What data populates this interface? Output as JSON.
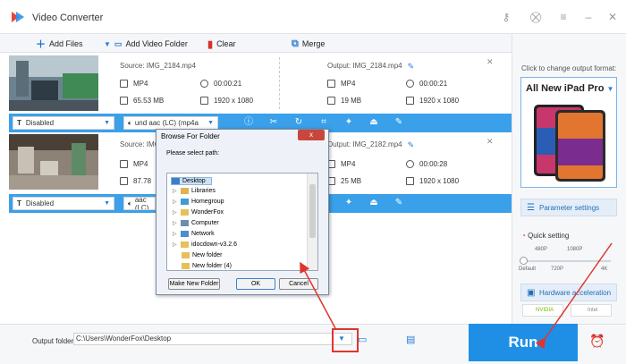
{
  "app": {
    "title": "Video Converter"
  },
  "toolbar": {
    "add_files": "Add Files",
    "add_video_folder": "Add Video Folder",
    "clear": "Clear",
    "merge": "Merge"
  },
  "files": [
    {
      "source": "Source: IMG_2184.mp4",
      "src_format": "MP4",
      "src_duration": "00:00:21",
      "src_size": "65.53 MB",
      "src_resolution": "1920 x 1080",
      "output": "Output: IMG_2184.mp4",
      "out_format": "MP4",
      "out_duration": "00:00:21",
      "out_size": "19 MB",
      "out_resolution": "1920 x 1080",
      "subtitle": "Disabled",
      "audio": "und aac (LC) (mp4a"
    },
    {
      "source": "Source: IMG_2182.mp4",
      "src_format": "MP4",
      "src_duration": "",
      "src_size": "87.78",
      "src_resolution": "",
      "output": "Output: IMG_2182.mp4",
      "out_format": "MP4",
      "out_duration": "00:00:28",
      "out_size": "25 MB",
      "out_resolution": "1920 x 1080",
      "subtitle": "Disabled",
      "audio": "und aac (LC) (mp4a"
    }
  ],
  "dialog": {
    "title": "Browse For Folder",
    "close": "x",
    "prompt": "Please select path:",
    "tree": [
      "Desktop",
      "Libraries",
      "Homegroup",
      "WonderFox",
      "Computer",
      "Network",
      "idocdown-v3.2.6",
      "New folder",
      "New folder (4)"
    ],
    "make_new_folder": "Make New Folder",
    "ok": "OK",
    "cancel": "Cancel"
  },
  "right_panel": {
    "hint": "Click to change output format:",
    "format": "All New iPad Pro",
    "param_settings": "Parameter settings",
    "quick_setting": "Quick setting",
    "q_top": [
      "480P",
      "1080P"
    ],
    "q_bottom": [
      "Default",
      "720P",
      "4K"
    ],
    "hw_accel": "Hardware acceleration",
    "nvidia": "NVIDIA",
    "intel": "Intel"
  },
  "bottom": {
    "output_folder_label": "Output folder:",
    "output_folder_value": "C:\\Users\\WonderFox\\Desktop",
    "run": "Run"
  },
  "colors": {
    "accent": "#3aa0ea",
    "run": "#1f8fe6",
    "annotation": "#e0352f"
  }
}
